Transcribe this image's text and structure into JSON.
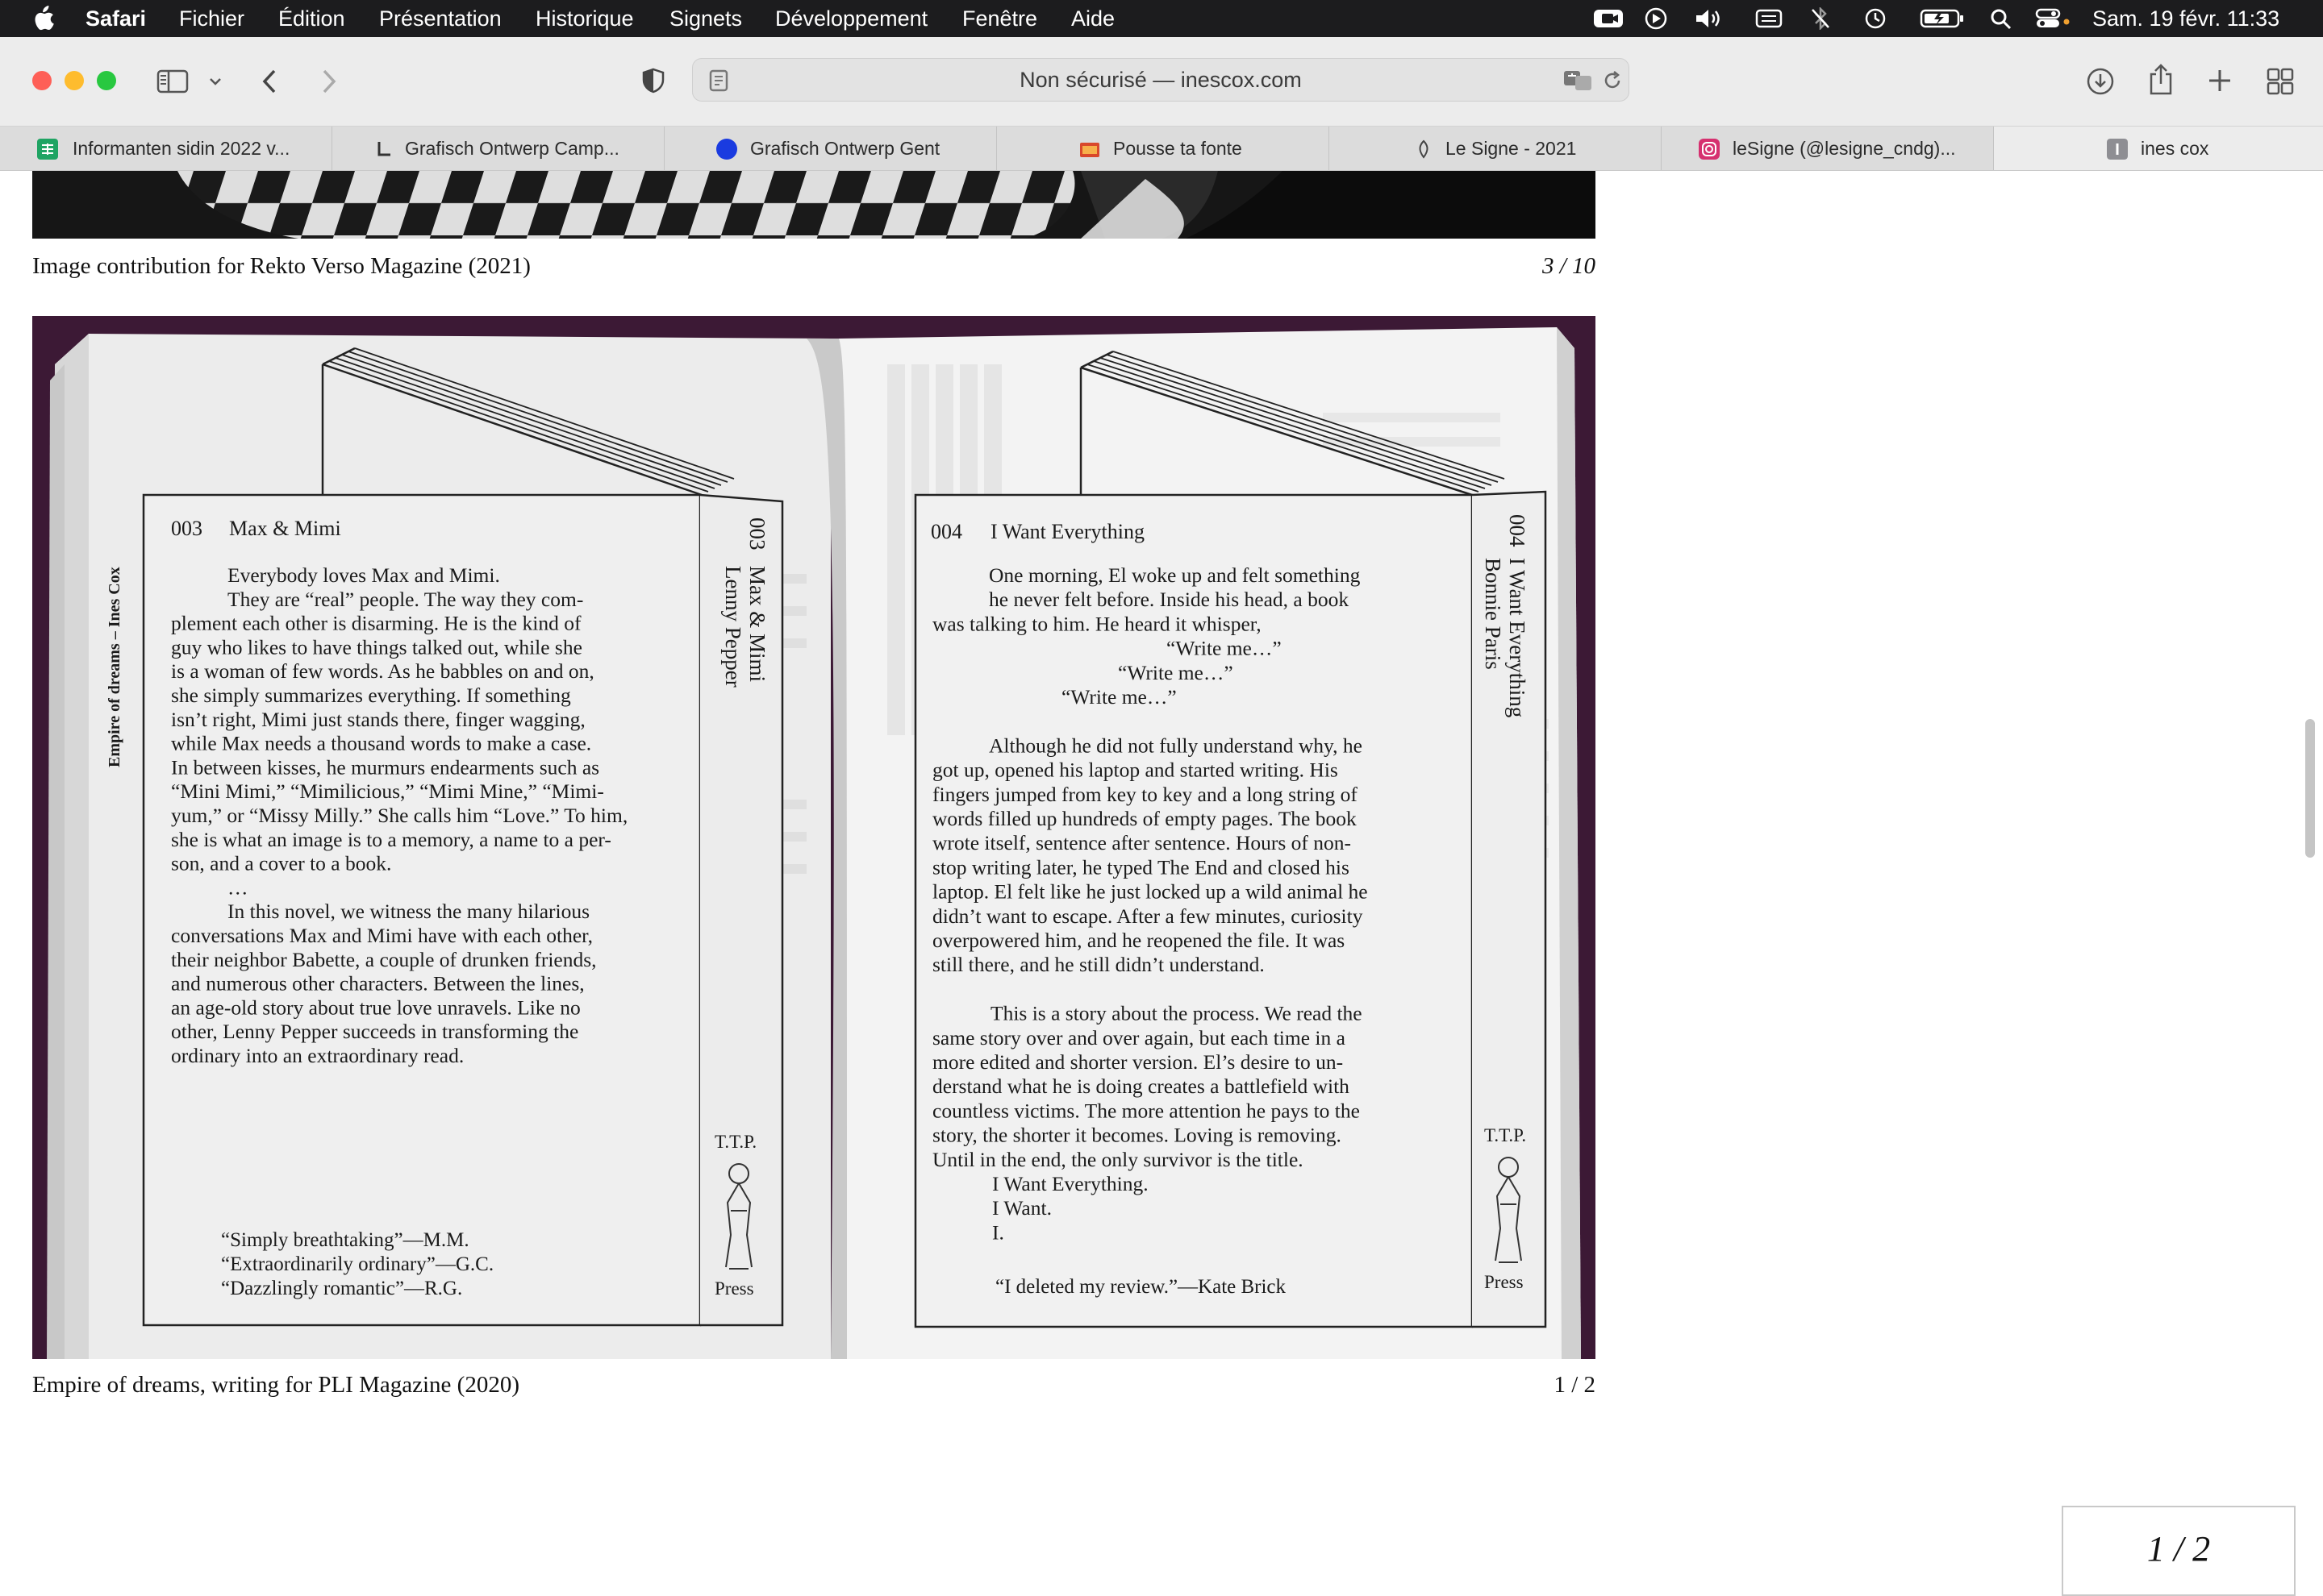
{
  "menubar": {
    "app": "Safari",
    "items": [
      "Fichier",
      "Édition",
      "Présentation",
      "Historique",
      "Signets",
      "Développement",
      "Fenêtre",
      "Aide"
    ],
    "datetime": "Sam. 19 févr. 11:33"
  },
  "toolbar": {
    "address": "Non sécurisé — inescox.com"
  },
  "tabs": [
    {
      "title": "Informanten sidin 2022 v...",
      "icon": "sheets-icon",
      "color": "#1fa463"
    },
    {
      "title": "Grafisch Ontwerp Camp...",
      "icon": "logo-icon",
      "color": "#444444"
    },
    {
      "title": "Grafisch Ontwerp Gent",
      "icon": "blue-dot-icon",
      "color": "#1a3be0"
    },
    {
      "title": "Pousse ta fonte",
      "icon": "folder-icon",
      "color": "#d9482b"
    },
    {
      "title": "Le Signe - 2021",
      "icon": "le-signe-icon",
      "color": "#555555"
    },
    {
      "title": "leSigne (@lesigne_cndg)...",
      "icon": "instagram-icon",
      "color": "#d6306f"
    },
    {
      "title": "ines cox",
      "icon": "letter-i-icon",
      "color": "#8e8e93",
      "active": true
    }
  ],
  "page": {
    "caption_top": "Image contribution for Rekto Verso Magazine (2021)",
    "counter_top": "3 / 10",
    "caption_bottom": "Empire of dreams, writing for PLI Magazine (2020)",
    "counter_bottom": "1 / 2",
    "pager": "1 / 2"
  },
  "book": {
    "spine_text": "Empire of dreams – Ines Cox",
    "left": {
      "number": "003",
      "title": "Max & Mimi",
      "side_number": "003",
      "side_title": "Max & Mimi",
      "side_author": "Lenny Pepper",
      "lines": [
        "Everybody loves Max and Mimi.",
        "They are “real” people. The way they com-",
        "plement each other is disarming. He is the kind of",
        "guy who likes to have things talked out, while she",
        "is a woman of few words. As he babbles on and on,",
        "she simply summarizes everything. If something",
        "isn’t right, Mimi just stands there, finger wagging,",
        "while Max needs a thousand words to make a case.",
        "In between kisses, he murmurs endearments such as",
        "“Mini Mimi,” “Mimilicious,” “Mimi Mine,” “Mimi-",
        "yum,” or “Missy Milly.” She calls him “Love.” To him,",
        "she is what an image is to a memory, a name to a per-",
        "son, and a cover to a book.",
        "…",
        "In this novel, we witness the many hilarious",
        "conversations Max and Mimi have with each other,",
        "their neighbor Babette, a couple of drunken friends,",
        "and numerous other characters. Between the lines,",
        "an age-old story about true love unravels. Like no",
        "other, Lenny Pepper succeeds in transforming the",
        "ordinary into an extraordinary read."
      ],
      "quotes": [
        "“Simply breathtaking”—M.M.",
        "“Extraordinarily ordinary”—G.C.",
        "“Dazzlingly romantic”—R.G."
      ],
      "publisher_top": "T.T.P.",
      "publisher_bottom": "Press"
    },
    "right": {
      "number": "004",
      "title": "I Want Everything",
      "side_number": "004",
      "side_title": "I Want Everything",
      "side_author": "Bonnie Paris",
      "lines": [
        "One morning, El woke up and felt something",
        "he never felt before. Inside his head, a book",
        "was talking to him. He heard it whisper,",
        "“Write me…”",
        "“Write me…”",
        "“Write me…”",
        "",
        "Although he did not fully understand why, he",
        "got up, opened his laptop and started writing. His",
        "fingers jumped from key to key and a long string of",
        "words filled up hundreds of empty pages. The book",
        "wrote itself, sentence after sentence. Hours of non-",
        "stop writing later, he typed The End and closed his",
        "laptop. El felt like he just locked up a wild animal he",
        "didn’t want to escape. After a few minutes, curiosity",
        "overpowered him, and he reopened the file. It was",
        "still there, and he still didn’t understand.",
        "",
        "This is a story about the process. We read the",
        "same story over and over again, but each time in a",
        "more edited and shorter version. El’s desire to un-",
        "derstand what he is doing creates a battlefield with",
        "countless victims. The more attention he pays to the",
        "story, the shorter it becomes. Loving is removing.",
        "Until in the end, the only survivor is the title.",
        "I Want Everything.",
        "I Want.",
        "I."
      ],
      "quote": "“I deleted my review.”—Kate Brick",
      "publisher_top": "T.T.P.",
      "publisher_bottom": "Press"
    }
  }
}
